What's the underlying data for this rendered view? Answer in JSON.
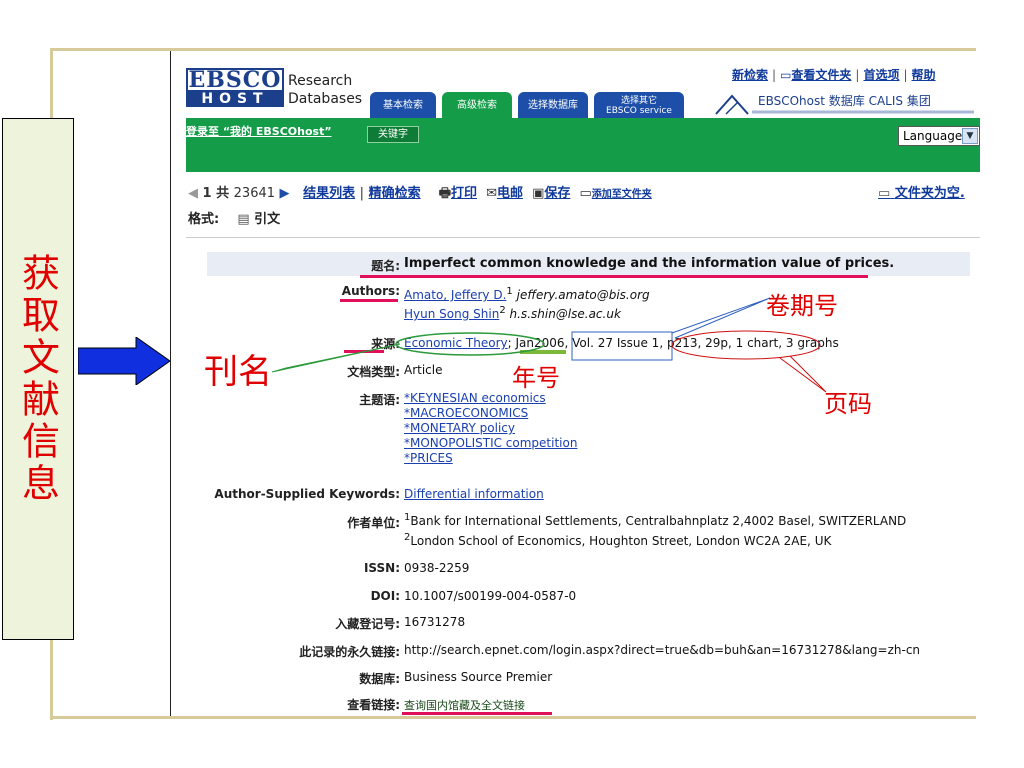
{
  "side_title": "获取文献信息",
  "header": {
    "logo_top": "EBSCO",
    "logo_bottom": "HOST",
    "brand_line1": "Research",
    "brand_line2": "Databases",
    "tabs": [
      "基本检索",
      "高级检索",
      "选择数据库",
      "选择其它\nEBSCO service"
    ],
    "top_links": [
      "新检索",
      "查看文件夹",
      "首选项",
      "帮助"
    ],
    "calis_label": "EBSCOhost 数据库 CALIS 集团",
    "login_link": "登录至 “我的 EBSCOhost”",
    "keyword_button": "关键字",
    "language": "Language"
  },
  "nav": {
    "position": "1",
    "total_label": "共",
    "total": "23641",
    "result_list": "结果列表",
    "refine": "精确检索",
    "print": "打印",
    "email": "电邮",
    "save": "保存",
    "add_folder": "添加至文件夹",
    "folder_empty": "文件夹为空."
  },
  "format": {
    "label": "格式:",
    "value": "引文"
  },
  "record": {
    "title_label": "题名:",
    "title": "Imperfect common knowledge and the information value of prices.",
    "authors_label": "Authors:",
    "author1": "Amato, Jeffery D.",
    "author1_sup": "1",
    "author1_email": "jeffery.amato@bis.org",
    "author2": "Hyun Song Shin",
    "author2_sup": "2",
    "author2_email": "h.s.shin@lse.ac.uk",
    "source_label": "来源:",
    "journal": "Economic Theory",
    "date": "Jan2006",
    "volume_issue": "Vol. 27 Issue 1",
    "pages": "p213, 29p, 1 chart, 3 graphs",
    "doctype_label": "文档类型:",
    "doctype": "Article",
    "subjects_label": "主题语:",
    "subjects": [
      "*KEYNESIAN economics",
      "*MACROECONOMICS",
      "*MONETARY policy",
      "*MONOPOLISTIC competition",
      "*PRICES"
    ],
    "keywords_label": "Author-Supplied Keywords:",
    "keywords": "Differential information",
    "affil_label": "作者单位:",
    "affil1_sup": "1",
    "affil1": "Bank for International Settlements, Centralbahnplatz 2,4002 Basel, SWITZERLAND",
    "affil2_sup": "2",
    "affil2": "London School of Economics, Houghton Street, London WC2A 2AE, UK",
    "issn_label": "ISSN:",
    "issn": "0938-2259",
    "doi_label": "DOI:",
    "doi": "10.1007/s00199-004-0587-0",
    "accession_label": "入藏登记号:",
    "accession": "16731278",
    "permalink_label": "此记录的永久链接:",
    "permalink": "http://search.epnet.com/login.aspx?direct=true&db=buh&an=16731278&lang=zh-cn",
    "database_label": "数据库:",
    "database": "Business Source Premier",
    "viewlinks_label": "查看链接:",
    "viewlinks": "查询国内馆藏及全文链接"
  },
  "annotations": {
    "journal": "刊名",
    "year": "年号",
    "volume": "卷期号",
    "pages": "页码"
  },
  "colors": {
    "accent_red": "#e00000",
    "ebsco_green": "#149c49",
    "link_blue": "#1a3fb0"
  }
}
